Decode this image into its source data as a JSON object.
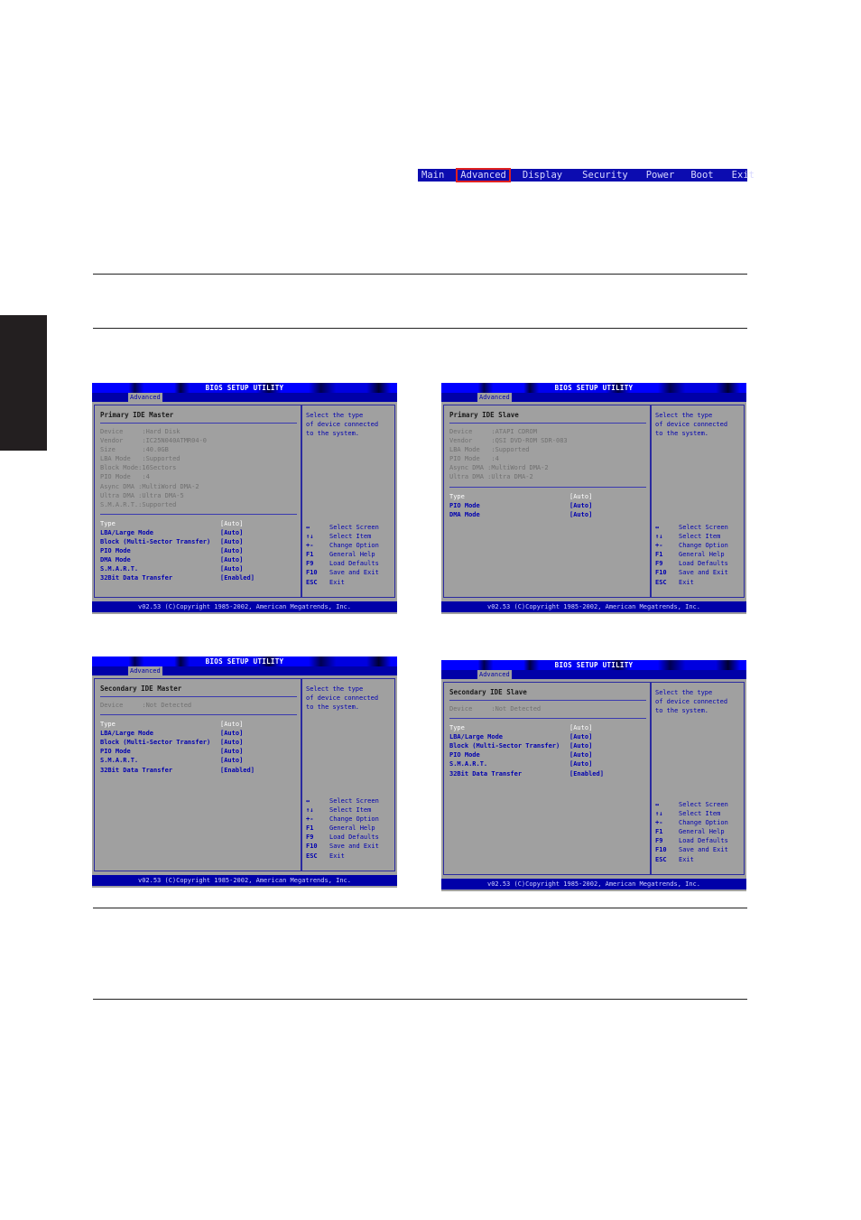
{
  "menubar": {
    "items": [
      "Main",
      "Advanced",
      "Display",
      "Security",
      "Power",
      "Boot",
      "Exit"
    ],
    "selected": "Advanced",
    "highlight_color": "#e02020"
  },
  "screens": [
    {
      "title": "BIOS SETUP UTILITY",
      "tab": "Advanced",
      "panel_title": "Primary IDE Master",
      "info": [
        "Device     :Hard Disk",
        "Vendor     :IC25N040ATMR04-0",
        "Size       :40.0GB",
        "LBA Mode   :Supported",
        "Block Mode:16Sectors",
        "PIO Mode   :4",
        "Async DMA :MultiWord DMA-2",
        "Ultra DMA :Ultra DMA-5",
        "S.M.A.R.T.:Supported"
      ],
      "options": [
        {
          "label": "Type",
          "value": "[Auto]"
        },
        {
          "label": "LBA/Large Mode",
          "value": "[Auto]"
        },
        {
          "label": "Block (Multi-Sector Transfer)",
          "value": "[Auto]"
        },
        {
          "label": "PIO Mode",
          "value": "[Auto]"
        },
        {
          "label": "DMA Mode",
          "value": "[Auto]"
        },
        {
          "label": "S.M.A.R.T.",
          "value": "[Auto]"
        },
        {
          "label": "32Bit Data Transfer",
          "value": "[Enabled]"
        }
      ],
      "help": "Select the type\nof device connected\nto the system.",
      "footer": "v02.53 (C)Copyright 1985-2002, American Megatrends, Inc."
    },
    {
      "title": "BIOS SETUP UTILITY",
      "tab": "Advanced",
      "panel_title": "Primary IDE Slave",
      "info": [
        "Device     :ATAPI CDROM",
        "Vendor     :QSI DVD-ROM SDR-083",
        "LBA Mode   :Supported",
        "PIO Mode   :4",
        "Async DMA :MultiWord DMA-2",
        "Ultra DMA :Ultra DMA-2"
      ],
      "options": [
        {
          "label": "Type",
          "value": "[Auto]"
        },
        {
          "label": "PIO Mode",
          "value": "[Auto]"
        },
        {
          "label": "DMA Mode",
          "value": "[Auto]"
        }
      ],
      "help": "Select the type\nof device connected\nto the system.",
      "footer": "v02.53 (C)Copyright 1985-2002, American Megatrends, Inc."
    },
    {
      "title": "BIOS SETUP UTILITY",
      "tab": "Advanced",
      "panel_title": "Secondary IDE Master",
      "info": [
        "Device     :Not Detected"
      ],
      "options": [
        {
          "label": "Type",
          "value": "[Auto]"
        },
        {
          "label": "LBA/Large Mode",
          "value": "[Auto]"
        },
        {
          "label": "Block (Multi-Sector Transfer)",
          "value": "[Auto]"
        },
        {
          "label": "PIO Mode",
          "value": "[Auto]"
        },
        {
          "label": "S.M.A.R.T.",
          "value": "[Auto]"
        },
        {
          "label": "32Bit Data Transfer",
          "value": "[Enabled]"
        }
      ],
      "help": "Select the type\nof device connected\nto the system.",
      "footer": "v02.53 (C)Copyright 1985-2002, American Megatrends, Inc."
    },
    {
      "title": "BIOS SETUP UTILITY",
      "tab": "Advanced",
      "panel_title": "Secondary IDE Slave",
      "info": [
        "Device     :Not Detected"
      ],
      "options": [
        {
          "label": "Type",
          "value": "[Auto]"
        },
        {
          "label": "LBA/Large Mode",
          "value": "[Auto]"
        },
        {
          "label": "Block (Multi-Sector Transfer)",
          "value": "[Auto]"
        },
        {
          "label": "PIO Mode",
          "value": "[Auto]"
        },
        {
          "label": "S.M.A.R.T.",
          "value": "[Auto]"
        },
        {
          "label": "32Bit Data Transfer",
          "value": "[Enabled]"
        }
      ],
      "help": "Select the type\nof device connected\nto the system.",
      "footer": "v02.53 (C)Copyright 1985-2002, American Megatrends, Inc."
    }
  ],
  "keys": [
    {
      "key": "↔",
      "action": "Select Screen"
    },
    {
      "key": "↑↓",
      "action": "Select Item"
    },
    {
      "key": "+-",
      "action": "Change Option"
    },
    {
      "key": "F1",
      "action": "General Help"
    },
    {
      "key": "F9",
      "action": "Load Defaults"
    },
    {
      "key": "F10",
      "action": "Save and Exit"
    },
    {
      "key": "ESC",
      "action": "Exit"
    }
  ]
}
